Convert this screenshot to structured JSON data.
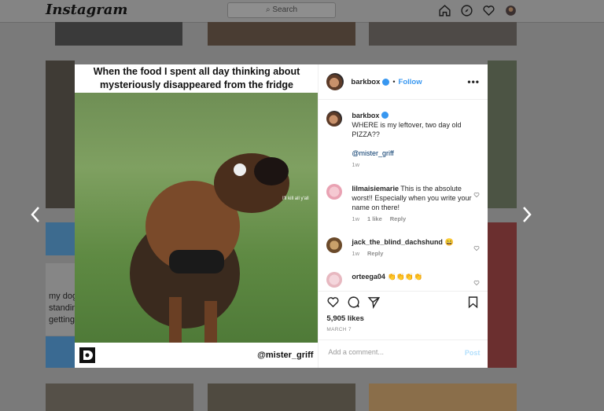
{
  "nav": {
    "logo": "Instagram",
    "search_placeholder": "Search"
  },
  "feed": {
    "caption_fragment": "my dog standin getting"
  },
  "post": {
    "headline": "When the food I spent all day thinking about mysteriously disappeared from the fridge",
    "media_handle": "@mister_griff",
    "dog_caption": "I'll kill all y'all",
    "author": "barkbox",
    "follow_label": "Follow",
    "more_label": "•••",
    "caption": {
      "user": "barkbox",
      "text": "WHERE is my leftover, two day old PIZZA??",
      "mention": "@mister_griff",
      "time": "1w"
    },
    "comments": [
      {
        "user": "lilmaisiemarie",
        "text": "This is the absolute worst!! Especially when you write your name on there!",
        "time": "1w",
        "likes": "1 like",
        "reply": "Reply"
      },
      {
        "user": "jack_the_blind_dachshund",
        "text": "😄",
        "time": "1w",
        "reply": "Reply"
      },
      {
        "user": "orteega04",
        "text": "👏👏👏👏"
      }
    ],
    "likes": "5,905 likes",
    "date": "MARCH 7",
    "add_comment_placeholder": "Add a comment...",
    "post_label": "Post"
  },
  "colors": {
    "accent": "#3897f0",
    "text": "#262626",
    "muted": "#8e8e8e",
    "overlay": "#7a7a7a"
  }
}
